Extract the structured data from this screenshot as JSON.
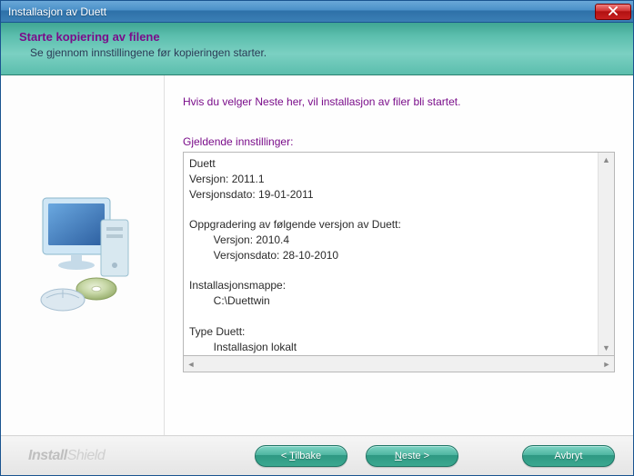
{
  "titlebar": {
    "title": "Installasjon av Duett"
  },
  "header": {
    "title": "Starte kopiering av filene",
    "subtitle": "Se gjennom innstillingene før kopieringen starter."
  },
  "content": {
    "intro": "Hvis du velger Neste her, vil installasjon av filer bli startet.",
    "settings_label": "Gjeldende innstillinger:",
    "settings_text": "Duett\nVersjon: 2011.1\nVersjonsdato: 19-01-2011\n\nOppgradering av følgende versjon av Duett:\n        Versjon: 2010.4\n        Versjonsdato: 28-10-2010\n\nInstallasjonsmappe:\n        C:\\Duettwin\n\nType Duett:\n        Installasjon lokalt"
  },
  "footer": {
    "brand_bold": "Install",
    "brand_light": "Shield",
    "back": "< Tilbake",
    "next": "Neste >",
    "cancel": "Avbryt"
  }
}
